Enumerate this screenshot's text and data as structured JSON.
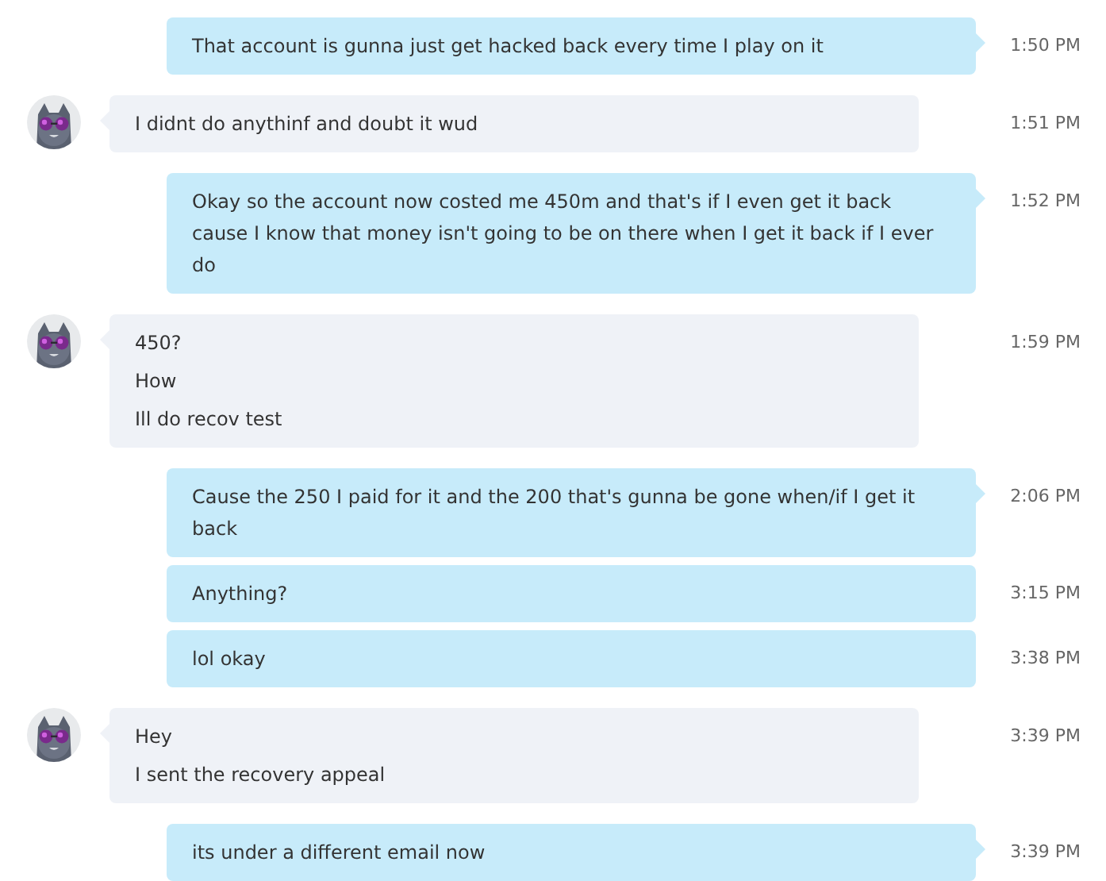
{
  "messages": [
    {
      "kind": "outgoing",
      "tail": true,
      "lines": [
        "That account is gunna just get hacked back every time I play on it"
      ],
      "time": "1:50 PM"
    },
    {
      "kind": "incoming",
      "tail": true,
      "lines": [
        "I didnt do anythinf and doubt it wud"
      ],
      "time": "1:51 PM"
    },
    {
      "kind": "outgoing",
      "tail": true,
      "lines": [
        "Okay so the account now costed me 450m and that's if I even get it back cause I know that money isn't going to be on there when I get it back if I ever do"
      ],
      "time": "1:52 PM"
    },
    {
      "kind": "incoming",
      "tail": true,
      "lines": [
        "450?",
        "How",
        "Ill do recov test"
      ],
      "time": "1:59 PM"
    },
    {
      "kind": "outgoing",
      "tail": true,
      "lines": [
        "Cause the 250 I paid for it and the 200 that's gunna be gone when/if I get it back"
      ],
      "time": "2:06 PM"
    },
    {
      "kind": "outgoing",
      "tail": false,
      "lines": [
        "Anything?"
      ],
      "time": "3:15 PM"
    },
    {
      "kind": "outgoing",
      "tail": false,
      "lines": [
        "lol okay"
      ],
      "time": "3:38 PM"
    },
    {
      "kind": "incoming",
      "tail": true,
      "lines": [
        "Hey",
        "I sent the recovery appeal"
      ],
      "time": "3:39 PM"
    },
    {
      "kind": "outgoing",
      "tail": true,
      "lines": [
        "its under a different email now"
      ],
      "time": "3:39 PM"
    }
  ]
}
